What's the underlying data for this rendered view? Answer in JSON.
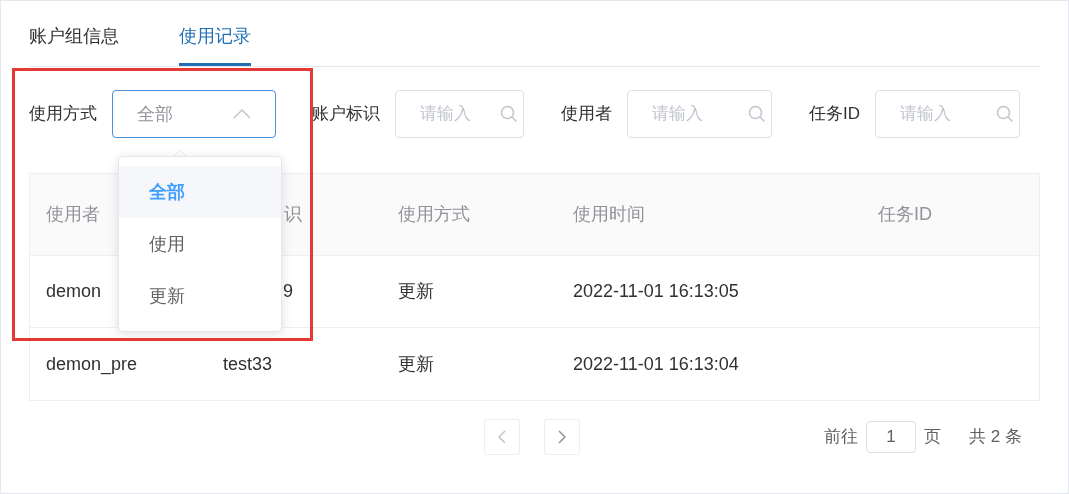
{
  "tabs": [
    {
      "label": "账户组信息",
      "selected": false
    },
    {
      "label": "使用记录",
      "selected": true
    }
  ],
  "filters": [
    {
      "kind": "select",
      "label": "使用方式",
      "value": "全部",
      "expanded": true
    },
    {
      "kind": "search",
      "label": "账户标识",
      "placeholder": "请输入"
    },
    {
      "kind": "search",
      "label": "使用者",
      "placeholder": "请输入"
    },
    {
      "kind": "search",
      "label": "任务ID",
      "placeholder": "请输入"
    }
  ],
  "dropdown_options": [
    {
      "label": "全部",
      "selected": true
    },
    {
      "label": "使用",
      "selected": false
    },
    {
      "label": "更新",
      "selected": false
    }
  ],
  "table": {
    "columns": [
      "使用者",
      "识",
      "使用方式",
      "使用时间",
      "任务ID"
    ],
    "rows": [
      [
        "demon",
        "9",
        "更新",
        "2022-11-01 16:13:05",
        ""
      ],
      [
        "demon_pre",
        "test33",
        "更新",
        "2022-11-01 16:13:04",
        ""
      ]
    ]
  },
  "pagination": {
    "goto_label": "前往",
    "page": "1",
    "page_suffix": "页",
    "total": "共 2 条"
  }
}
